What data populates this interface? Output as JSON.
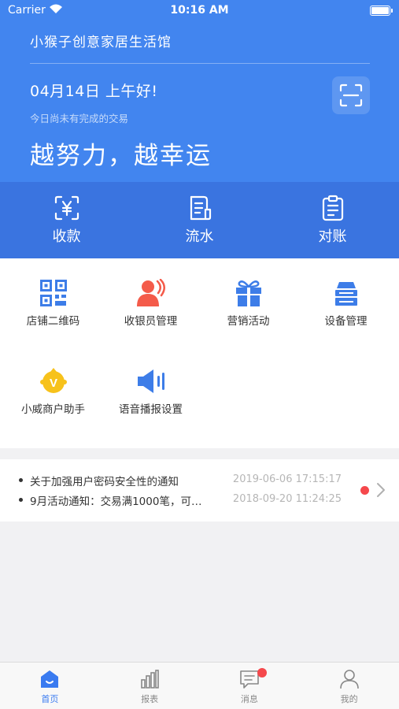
{
  "status_bar": {
    "carrier": "Carrier",
    "time": "10:16 AM"
  },
  "header": {
    "store_name": "小猴子创意家居生活馆",
    "greeting": "04月14日  上午好!",
    "subtext": "今日尚未有完成的交易",
    "slogan": "越努力，越幸运",
    "scan_icon": "scan-icon"
  },
  "actions": [
    {
      "label": "收款",
      "icon": "yuan-scan-icon"
    },
    {
      "label": "流水",
      "icon": "document-icon"
    },
    {
      "label": "对账",
      "icon": "clipboard-icon"
    }
  ],
  "grid": [
    {
      "label": "店铺二维码",
      "icon": "qr-code-icon",
      "color": "#3d7de8"
    },
    {
      "label": "收银员管理",
      "icon": "cashier-icon",
      "color": "#f45b4a"
    },
    {
      "label": "营销活动",
      "icon": "gift-icon",
      "color": "#3d7de8"
    },
    {
      "label": "设备管理",
      "icon": "device-icon",
      "color": "#3d7de8"
    },
    {
      "label": "小威商户助手",
      "icon": "assistant-icon",
      "color": "#f7c21b"
    },
    {
      "label": "语音播报设置",
      "icon": "speaker-icon",
      "color": "#3d7de8"
    }
  ],
  "notices": [
    {
      "text": "关于加强用户密码安全性的通知",
      "time": "2019-06-06 17:15:17"
    },
    {
      "text": "9月活动通知：交易满1000笔，可…",
      "time": "2018-09-20 11:24:25"
    }
  ],
  "tabs": [
    {
      "label": "首页",
      "icon": "home-icon",
      "active": true
    },
    {
      "label": "报表",
      "icon": "bar-chart-icon",
      "active": false
    },
    {
      "label": "消息",
      "icon": "message-icon",
      "active": false
    },
    {
      "label": "我的",
      "icon": "user-icon",
      "active": false
    }
  ],
  "colors": {
    "header_blue": "#4285ef",
    "action_blue": "#3a74e0",
    "accent": "#3a7bf0",
    "badge_red": "#f5484c"
  }
}
